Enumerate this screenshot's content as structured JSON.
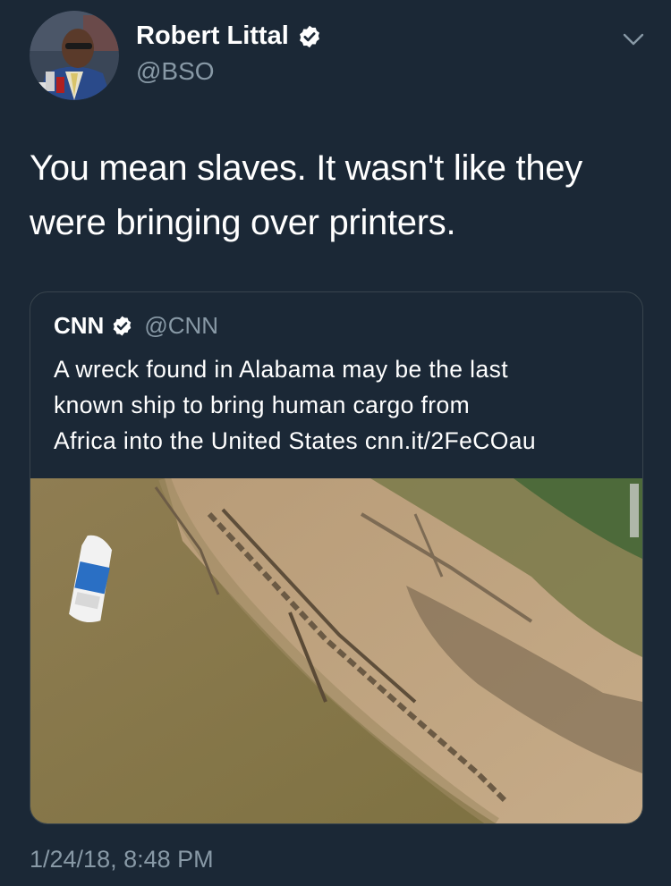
{
  "author": {
    "name": "Robert Littal",
    "handle": "@BSO",
    "verified": true,
    "avatar_icon": "avatar-photo"
  },
  "tweet": {
    "text_line1": "You mean slaves. It wasn't like they",
    "text_line2": "were bringing over printers.",
    "timestamp": "1/24/18, 8:48 PM"
  },
  "quoted": {
    "name": "CNN",
    "handle": "@CNN",
    "verified": true,
    "text_line1": "A wreck found in Alabama may be the last",
    "text_line2": "known ship to bring human cargo from",
    "text_line3": "Africa into the United States cnn.it/2FeCOau",
    "media_icon": "aerial-shipwreck-photo"
  },
  "icons": {
    "verified": "verified-badge-icon",
    "menu": "chevron-down-icon"
  },
  "colors": {
    "background": "#1b2836",
    "text_primary": "#ffffff",
    "text_secondary": "#8899a6",
    "border": "#38444d",
    "verified_badge": "#ffffff"
  }
}
